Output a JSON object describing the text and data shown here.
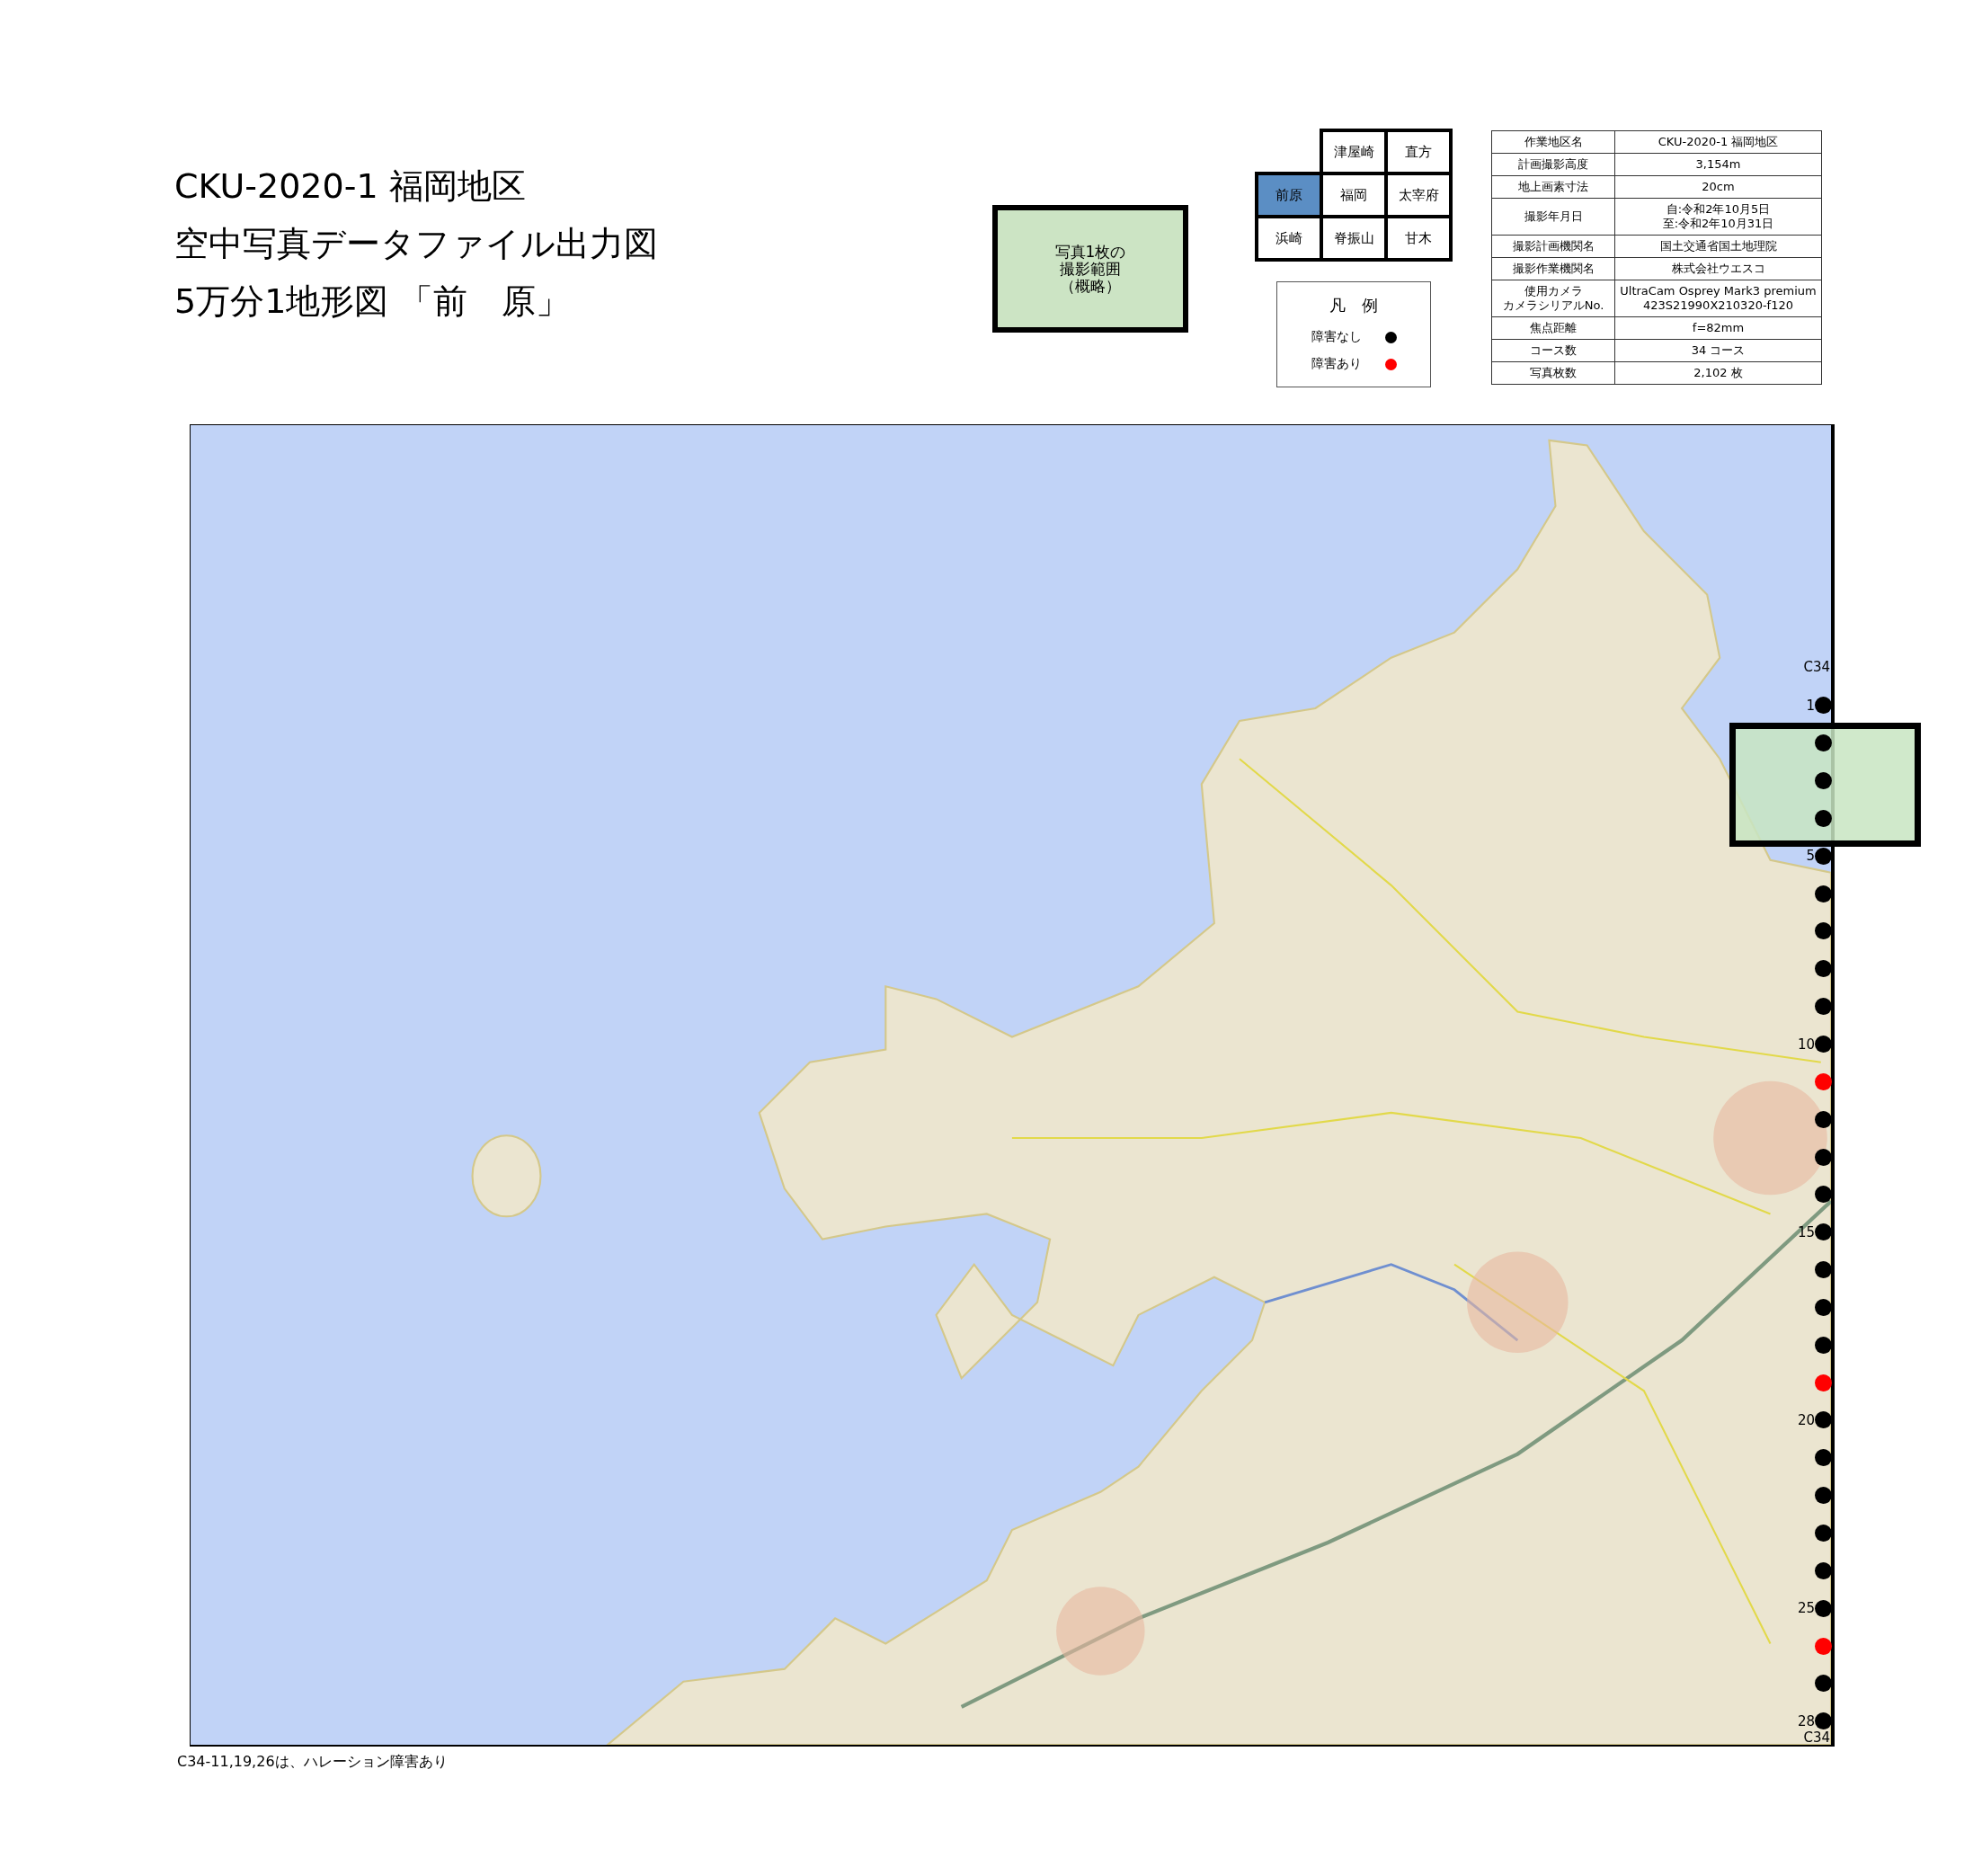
{
  "title_lines": [
    "CKU-2020-1 福岡地区",
    "空中写真データファイル出力図",
    "5万分1地形図 「前　原」"
  ],
  "sample_footprint": {
    "lines": [
      "写真1枚の",
      "撮影範囲",
      "（概略）"
    ]
  },
  "index_map": {
    "rows": [
      [
        null,
        {
          "label": "津屋崎",
          "selected": false
        },
        {
          "label": "直方",
          "selected": false
        }
      ],
      [
        {
          "label": "前原",
          "selected": true
        },
        {
          "label": "福岡",
          "selected": false
        },
        {
          "label": "太宰府",
          "selected": false
        }
      ],
      [
        {
          "label": "浜崎",
          "selected": false
        },
        {
          "label": "脊振山",
          "selected": false
        },
        {
          "label": "甘木",
          "selected": false
        }
      ]
    ]
  },
  "legend": {
    "title": "凡　例",
    "items": [
      {
        "label": "障害なし",
        "color": "#000000"
      },
      {
        "label": "障害あり",
        "color": "#ff0000"
      }
    ]
  },
  "info_table": [
    {
      "label": [
        "作業地区名"
      ],
      "value": [
        "CKU-2020-1 福岡地区"
      ]
    },
    {
      "label": [
        "計画撮影高度"
      ],
      "value": [
        "3,154m"
      ]
    },
    {
      "label": [
        "地上画素寸法"
      ],
      "value": [
        "20cm"
      ]
    },
    {
      "label": [
        "撮影年月日"
      ],
      "value": [
        "自:令和2年10月5日",
        "至:令和2年10月31日"
      ]
    },
    {
      "label": [
        "撮影計画機関名"
      ],
      "value": [
        "国土交通省国土地理院"
      ]
    },
    {
      "label": [
        "撮影作業機関名"
      ],
      "value": [
        "株式会社ウエスコ"
      ]
    },
    {
      "label": [
        "使用カメラ",
        "カメラシリアルNo."
      ],
      "value": [
        "UltraCam Osprey Mark3 premium",
        "423S21990X210320-f120"
      ]
    },
    {
      "label": [
        "焦点距離"
      ],
      "value": [
        "f=82mm"
      ]
    },
    {
      "label": [
        "コース数"
      ],
      "value": [
        "34 コース"
      ]
    },
    {
      "label": [
        "写真枚数"
      ],
      "value": [
        "2,102 枚"
      ]
    }
  ],
  "flight_line": {
    "course_start": "C34",
    "course_end": "C34",
    "photos": [
      {
        "label": "1",
        "obstructed": false
      },
      {
        "obstructed": false
      },
      {
        "obstructed": false
      },
      {
        "obstructed": false
      },
      {
        "label": "5",
        "obstructed": false
      },
      {
        "obstructed": false
      },
      {
        "obstructed": false
      },
      {
        "obstructed": false
      },
      {
        "obstructed": false
      },
      {
        "label": "10",
        "obstructed": false
      },
      {
        "obstructed": true
      },
      {
        "obstructed": false
      },
      {
        "obstructed": false
      },
      {
        "obstructed": false
      },
      {
        "label": "15",
        "obstructed": false
      },
      {
        "obstructed": false
      },
      {
        "obstructed": false
      },
      {
        "obstructed": false
      },
      {
        "obstructed": true
      },
      {
        "label": "20",
        "obstructed": false
      },
      {
        "obstructed": false
      },
      {
        "obstructed": false
      },
      {
        "obstructed": false
      },
      {
        "obstructed": false
      },
      {
        "label": "25",
        "obstructed": false
      },
      {
        "obstructed": true
      },
      {
        "obstructed": false
      },
      {
        "label": "28",
        "obstructed": false
      }
    ]
  },
  "note": "C34-11,19,26は、ハレーション障害あり"
}
